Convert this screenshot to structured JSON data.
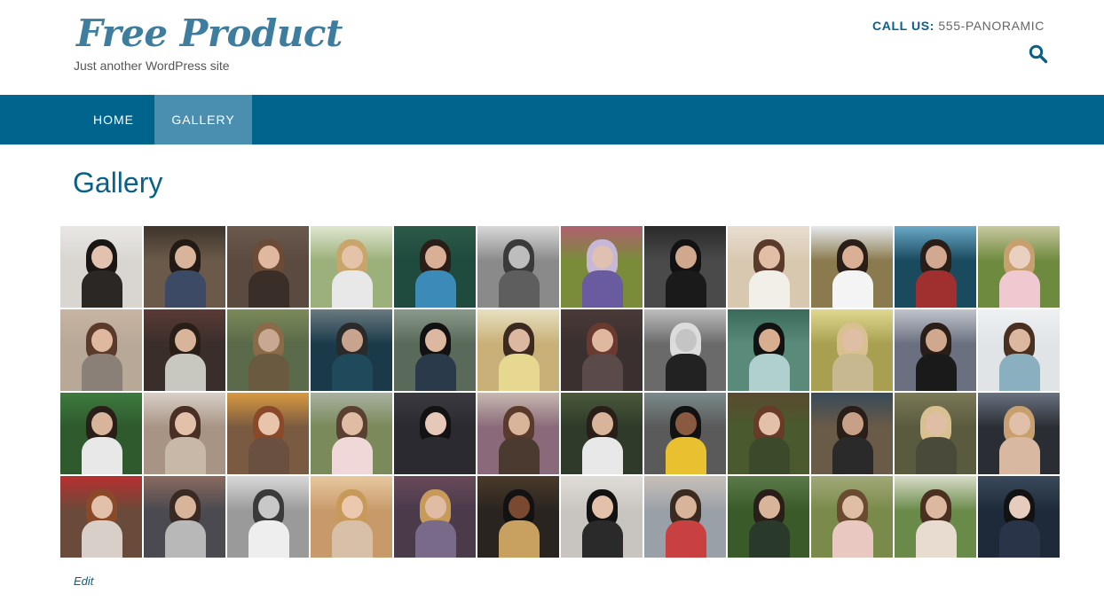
{
  "site": {
    "title": "Free Product",
    "tagline": "Just another WordPress site",
    "call_label": "CALL US:",
    "call_number": "555-PANORAMIC"
  },
  "nav": {
    "items": [
      "HOME",
      "GALLERY"
    ],
    "active": "GALLERY"
  },
  "page": {
    "title": "Gallery",
    "edit_label": "Edit"
  },
  "colors": {
    "brand": "#00648c",
    "nav_active": "#4a8fb0",
    "title_text": "#0a6088",
    "logo_text": "#3f7d9e"
  },
  "icons": {
    "search": "search-icon"
  },
  "gallery": {
    "columns": 12,
    "rows": 4,
    "tiles": [
      {
        "bg": "#d9d6d2",
        "sky": "#e9e7e4",
        "hair": "#1a1614",
        "skin": "#e2c1ae",
        "body": "#2a2725"
      },
      {
        "bg": "#6b5a4a",
        "sky": "#3e342b",
        "hair": "#221a14",
        "skin": "#d8b49a",
        "body": "#3c4a66"
      },
      {
        "bg": "#5a4a40",
        "sky": "#6a5a4e",
        "hair": "#6b4a36",
        "skin": "#e0b8a0",
        "body": "#3a2e28"
      },
      {
        "bg": "#9bb07a",
        "sky": "#dfe6cf",
        "hair": "#c9a46b",
        "skin": "#e4c3a9",
        "body": "#e8e8e8"
      },
      {
        "bg": "#1f4a3e",
        "sky": "#2c5a48",
        "hair": "#2a1e18",
        "skin": "#d9b095",
        "body": "#3c8ab8"
      },
      {
        "bg": "#8a8a8a",
        "sky": "#d8d8d8",
        "hair": "#3a3a3a",
        "skin": "#bdbdbd",
        "body": "#5e5e5e"
      },
      {
        "bg": "#7a8c3a",
        "sky": "#b06070",
        "hair": "#c8b8d8",
        "skin": "#e0c0b0",
        "body": "#6a5aa0"
      },
      {
        "bg": "#4a4a4a",
        "sky": "#2a2a2a",
        "hair": "#121212",
        "skin": "#d0a88e",
        "body": "#1a1a1a"
      },
      {
        "bg": "#d8c8b0",
        "sky": "#e8ddd0",
        "hair": "#5a3a2a",
        "skin": "#e2bea6",
        "body": "#f2eee8"
      },
      {
        "bg": "#8a7a4e",
        "sky": "#e6e9ec",
        "hair": "#2a1e18",
        "skin": "#d9b095",
        "body": "#f4f4f4"
      },
      {
        "bg": "#1a4a5e",
        "sky": "#6aa8c6",
        "hair": "#2a1e18",
        "skin": "#d2a890",
        "body": "#a03030"
      },
      {
        "bg": "#6e8a3e",
        "sky": "#c8c8a0",
        "hair": "#c8a070",
        "skin": "#ead0c0",
        "body": "#f0c8d0"
      },
      {
        "bg": "#b8a898",
        "sky": "#c8b4a2",
        "hair": "#5a3a2a",
        "skin": "#e0b8a0",
        "body": "#8a8078"
      },
      {
        "bg": "#3a2e2a",
        "sky": "#5a3a36",
        "hair": "#2a1e18",
        "skin": "#d8b49a",
        "body": "#c8c8c0"
      },
      {
        "bg": "#5a6a4a",
        "sky": "#7a8a5a",
        "hair": "#8a6a48",
        "skin": "#c8a890",
        "body": "#6a5a40"
      },
      {
        "bg": "#1a3a4a",
        "sky": "#6a7a80",
        "hair": "#2a2a2a",
        "skin": "#c8a48e",
        "body": "#1e4a5c"
      },
      {
        "bg": "#5a6a5a",
        "sky": "#8a9a8a",
        "hair": "#121212",
        "skin": "#dcb8a0",
        "body": "#2a3a4a"
      },
      {
        "bg": "#c8b078",
        "sky": "#e8e0c0",
        "hair": "#3a2a20",
        "skin": "#dcb8a0",
        "body": "#e6d890"
      },
      {
        "bg": "#3a3030",
        "sky": "#4a3a38",
        "hair": "#6a3a30",
        "skin": "#e0b8a0",
        "body": "#5a4a4a"
      },
      {
        "bg": "#6a6a6a",
        "sky": "#bdbdbd",
        "hair": "#dcdcdc",
        "skin": "#c4c4c4",
        "body": "#222222"
      },
      {
        "bg": "#5a8a7a",
        "sky": "#3a6a5a",
        "hair": "#121212",
        "skin": "#d8ae90",
        "body": "#b0d0d0"
      },
      {
        "bg": "#a8a050",
        "sky": "#e0d890",
        "hair": "#d8c090",
        "skin": "#e0bea6",
        "body": "#c8b890"
      },
      {
        "bg": "#6a7080",
        "sky": "#c0c4cc",
        "hair": "#2a1e18",
        "skin": "#cfa88e",
        "body": "#1a1a1a"
      },
      {
        "bg": "#e0e4e6",
        "sky": "#eef0f2",
        "hair": "#4a3020",
        "skin": "#dcb8a0",
        "body": "#8ab0c0"
      },
      {
        "bg": "#2e5a2e",
        "sky": "#3e7a3e",
        "hair": "#2a1e18",
        "skin": "#d8b49a",
        "body": "#e8e8e8"
      },
      {
        "bg": "#a89484",
        "sky": "#d8d0c8",
        "hair": "#4a3024",
        "skin": "#e2c0aa",
        "body": "#c8b8a8"
      },
      {
        "bg": "#7a5a40",
        "sky": "#d89a40",
        "hair": "#8a4a2a",
        "skin": "#e8c4aa",
        "body": "#6a5040"
      },
      {
        "bg": "#7a8a5a",
        "sky": "#a8b0a0",
        "hair": "#5a4030",
        "skin": "#e0bca4",
        "body": "#f0d8d8"
      },
      {
        "bg": "#2a2a30",
        "sky": "#3a3a40",
        "hair": "#121212",
        "skin": "#e6c8b8",
        "body": "#2a2a30"
      },
      {
        "bg": "#8a6a7a",
        "sky": "#c8b8b0",
        "hair": "#5a3a2a",
        "skin": "#d8b49a",
        "body": "#4a3a30"
      },
      {
        "bg": "#2e3a2a",
        "sky": "#4a5a3a",
        "hair": "#2a1e18",
        "skin": "#d8b49a",
        "body": "#e8e8e8"
      },
      {
        "bg": "#5a5a5a",
        "sky": "#7a8a8a",
        "hair": "#121212",
        "skin": "#8a5a40",
        "body": "#e8c030"
      },
      {
        "bg": "#4a5a2e",
        "sky": "#5a4a30",
        "hair": "#6a3a28",
        "skin": "#e2c0aa",
        "body": "#3a4a2a"
      },
      {
        "bg": "#6a5a48",
        "sky": "#384a58",
        "hair": "#2a1e18",
        "skin": "#c8a088",
        "body": "#2a2a2a"
      },
      {
        "bg": "#5a5a3e",
        "sky": "#7a7a58",
        "hair": "#d8c090",
        "skin": "#e0bea6",
        "body": "#4a4a3a"
      },
      {
        "bg": "#2a2e34",
        "sky": "#6a7280",
        "hair": "#c8a070",
        "skin": "#e0c0a8",
        "body": "#d8b8a0"
      },
      {
        "bg": "#6a4a3a",
        "sky": "#b83030",
        "hair": "#8a4a2a",
        "skin": "#e2c0aa",
        "body": "#d8d0c8"
      },
      {
        "bg": "#4a4a50",
        "sky": "#8a6a60",
        "hair": "#3a2a24",
        "skin": "#d8b49a",
        "body": "#b8b8b8"
      },
      {
        "bg": "#9a9a9a",
        "sky": "#d8d8d8",
        "hair": "#3a3a3a",
        "skin": "#c8c8c8",
        "body": "#eeeeee"
      },
      {
        "bg": "#c89a6a",
        "sky": "#e8c8a0",
        "hair": "#c89a5a",
        "skin": "#ecc8ae",
        "body": "#d8c0a8"
      },
      {
        "bg": "#4a3a4a",
        "sky": "#6a4a5a",
        "hair": "#c89a5a",
        "skin": "#e0bca4",
        "body": "#7a6a8a"
      },
      {
        "bg": "#2a2420",
        "sky": "#4a3a2a",
        "hair": "#121212",
        "skin": "#7a4a30",
        "body": "#c8a060"
      },
      {
        "bg": "#c8c4c0",
        "sky": "#e0dcd8",
        "hair": "#121212",
        "skin": "#e2c0aa",
        "body": "#2a2a2a"
      },
      {
        "bg": "#9aa0a8",
        "sky": "#c8c0b8",
        "hair": "#3a2a20",
        "skin": "#d8b49a",
        "body": "#c84040"
      },
      {
        "bg": "#3a5a2a",
        "sky": "#5a7a4a",
        "hair": "#2a1e18",
        "skin": "#d8b49a",
        "body": "#2a3a2a"
      },
      {
        "bg": "#7a8a4a",
        "sky": "#a0a878",
        "hair": "#6a4a30",
        "skin": "#e0bea6",
        "body": "#e8c8c0"
      },
      {
        "bg": "#6a8a4a",
        "sky": "#d8dcc8",
        "hair": "#4a3020",
        "skin": "#dcb8a0",
        "body": "#e8dcd0"
      },
      {
        "bg": "#1e2a3a",
        "sky": "#3a4a5a",
        "hair": "#121212",
        "skin": "#e6ccbc",
        "body": "#2a3448"
      }
    ]
  }
}
